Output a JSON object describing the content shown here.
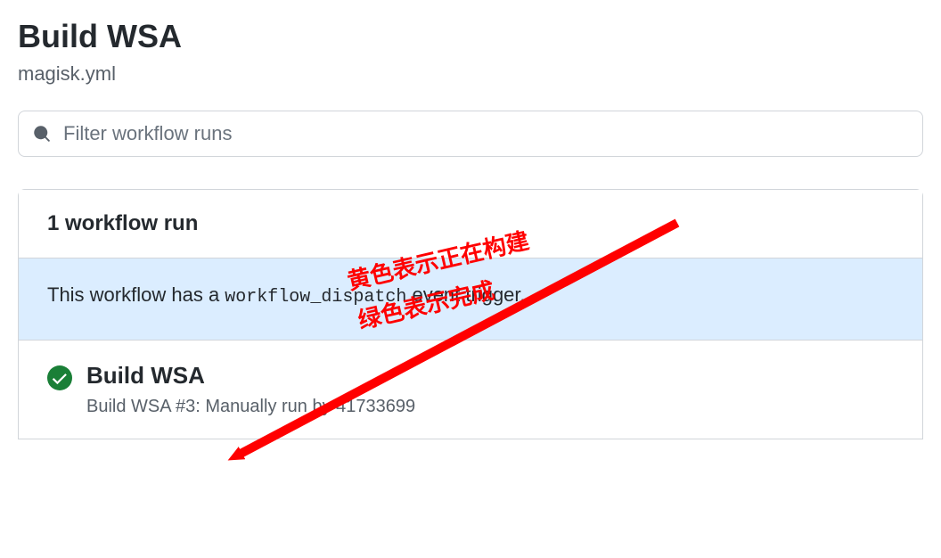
{
  "header": {
    "title": "Build WSA",
    "subtitle": "magisk.yml"
  },
  "search": {
    "placeholder": "Filter workflow runs"
  },
  "panel": {
    "count_label": "1 workflow run",
    "banner_prefix": "This workflow has a ",
    "banner_code": "workflow_dispatch",
    "banner_suffix": " event trigger."
  },
  "run": {
    "title": "Build WSA",
    "meta": "Build WSA #3: Manually run by 41733699"
  },
  "annotations": {
    "line1": "黄色表示正在构建",
    "line2": "绿色表示完成"
  },
  "colors": {
    "success": "#1a7f37",
    "annotation": "#ff0000",
    "banner_bg": "#dbedff"
  }
}
